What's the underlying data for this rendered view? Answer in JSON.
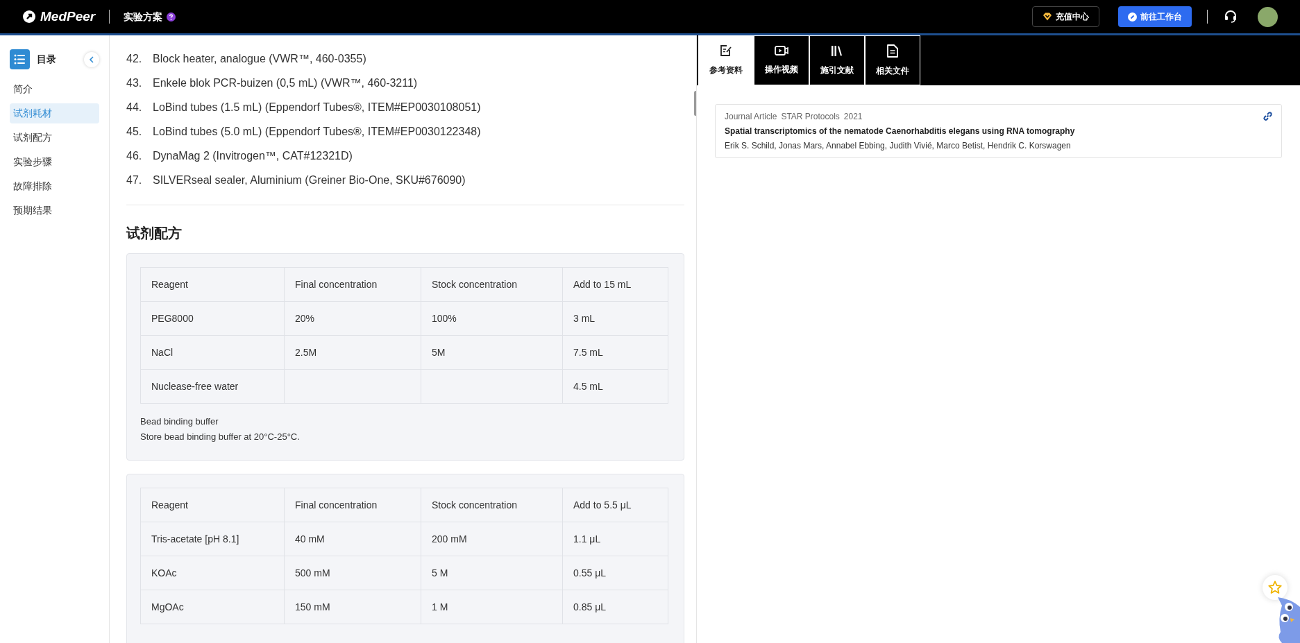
{
  "header": {
    "logo": "MedPeer",
    "section": "实验方案",
    "buttons": [
      {
        "label": "充值中心",
        "kind": "outline"
      },
      {
        "label": "前往工作台",
        "kind": "primary"
      }
    ]
  },
  "sidebar": {
    "title": "目录",
    "items": [
      {
        "label": "简介",
        "selected": false
      },
      {
        "label": "试剂耗材",
        "selected": true
      },
      {
        "label": "试剂配方",
        "selected": false
      },
      {
        "label": "实验步骤",
        "selected": false
      },
      {
        "label": "故障排除",
        "selected": false
      },
      {
        "label": "预期结果",
        "selected": false
      }
    ]
  },
  "materials": [
    {
      "number": "42.",
      "text": "Block heater, analogue (VWR™, 460-0355)"
    },
    {
      "number": "43.",
      "text": "Enkele blok PCR-buizen (0,5 mL) (VWR™, 460-3211)"
    },
    {
      "number": "44.",
      "text": "LoBind tubes (1.5 mL) (Eppendorf Tubes®, ITEM#EP0030108051)"
    },
    {
      "number": "45.",
      "text": "LoBind tubes (5.0 mL) (Eppendorf Tubes®, ITEM#EP0030122348)"
    },
    {
      "number": "46.",
      "text": "DynaMag 2 (Invitrogen™, CAT#12321D)"
    },
    {
      "number": "47.",
      "text": "SILVERseal sealer, Aluminium (Greiner Bio-One, SKU#676090)"
    }
  ],
  "section_title": "试剂配方",
  "recipes": [
    {
      "columns": [
        "Reagent",
        "Final concentration",
        "Stock concentration",
        "Add to 15 mL"
      ],
      "rows": [
        [
          "PEG8000",
          "20%",
          "100%",
          "3 mL"
        ],
        [
          "NaCl",
          "2.5M",
          "5M",
          "7.5 mL"
        ],
        [
          "Nuclease-free water",
          "",
          "",
          "4.5 mL"
        ]
      ],
      "notes": [
        "Bead binding buffer",
        "Store bead binding buffer at 20°C-25°C."
      ]
    },
    {
      "columns": [
        "Reagent",
        "Final concentration",
        "Stock concentration",
        "Add to 5.5 μL"
      ],
      "rows": [
        [
          "Tris-acetate [pH 8.1]",
          "40 mM",
          "200 mM",
          "1.1 μL"
        ],
        [
          "KOAc",
          "500 mM",
          "5 M",
          "0.55 μL"
        ],
        [
          "MgOAc",
          "150 mM",
          "1 M",
          "0.85 μL"
        ]
      ]
    }
  ],
  "right_panel": {
    "tabs": [
      {
        "label": "参考资料",
        "kind": "notes",
        "selected": true
      },
      {
        "label": "操作视频",
        "kind": "video",
        "selected": false
      },
      {
        "label": "施引文献",
        "kind": "books",
        "selected": false
      },
      {
        "label": "相关文件",
        "kind": "file",
        "selected": false
      }
    ],
    "references": [
      {
        "type": "Journal Article",
        "journal": "STAR Protocols",
        "year": "2021",
        "title": "Spatial transcriptomics of the nematode Caenorhabditis elegans using RNA tomography",
        "authors": "Erik S. Schild, Jonas Mars, Annabel Ebbing, Judith Vivié, Marco Betist, Hendrik C. Korswagen"
      }
    ]
  }
}
